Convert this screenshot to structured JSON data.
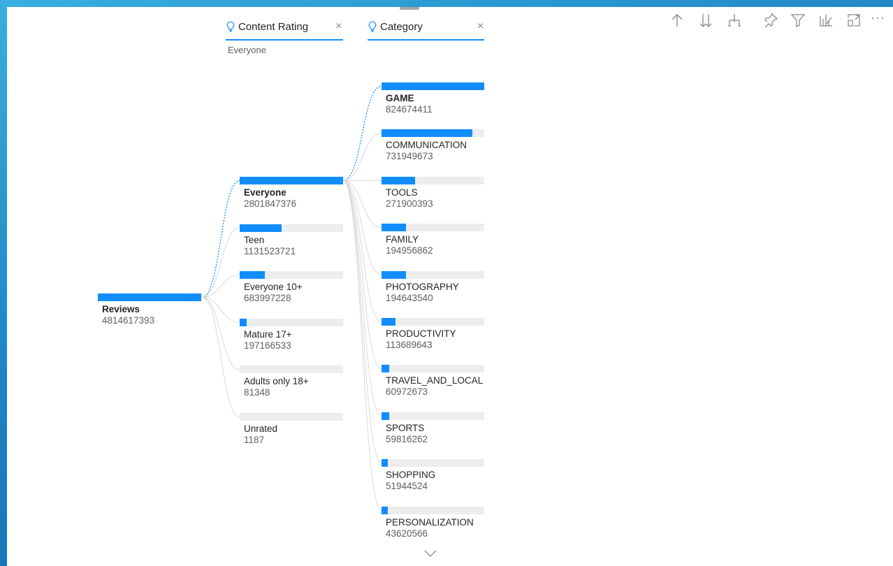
{
  "header": {
    "content_rating": {
      "title": "Content Rating",
      "subtitle": "Everyone",
      "close": "×"
    },
    "category": {
      "title": "Category",
      "close": "×"
    }
  },
  "toolbar": {
    "more": "···",
    "icons": [
      "drill-up-icon",
      "drill-down-icon",
      "expand-hierarchy-icon",
      "pin-icon",
      "filter-icon",
      "focus-mode-icon",
      "expand-icon",
      "more-options-icon"
    ]
  },
  "root": {
    "label": "Reviews",
    "value": "4814617393",
    "fraction": 1.0
  },
  "content_rating_nodes": [
    {
      "label": "Everyone",
      "value": "2801847376",
      "fraction": 1.0,
      "selected": true
    },
    {
      "label": "Teen",
      "value": "1131523721",
      "fraction": 0.4038,
      "selected": false
    },
    {
      "label": "Everyone 10+",
      "value": "683997228",
      "fraction": 0.2441,
      "selected": false
    },
    {
      "label": "Mature 17+",
      "value": "197166533",
      "fraction": 0.0704,
      "selected": false
    },
    {
      "label": "Adults only 18+",
      "value": "81348",
      "fraction": 3e-05,
      "selected": false
    },
    {
      "label": "Unrated",
      "value": "1187",
      "fraction": 4e-07,
      "selected": false
    }
  ],
  "category_nodes": [
    {
      "label": "GAME",
      "value": "824674411",
      "fraction": 1.0,
      "selected": true
    },
    {
      "label": "COMMUNICATION",
      "value": "731949673",
      "fraction": 0.8876,
      "selected": false
    },
    {
      "label": "TOOLS",
      "value": "271900393",
      "fraction": 0.3297,
      "selected": false
    },
    {
      "label": "FAMILY",
      "value": "194956862",
      "fraction": 0.2364,
      "selected": false
    },
    {
      "label": "PHOTOGRAPHY",
      "value": "194643540",
      "fraction": 0.236,
      "selected": false
    },
    {
      "label": "PRODUCTIVITY",
      "value": "113689643",
      "fraction": 0.1379,
      "selected": false
    },
    {
      "label": "TRAVEL_AND_LOCAL",
      "value": "60972673",
      "fraction": 0.0739,
      "selected": false
    },
    {
      "label": "SPORTS",
      "value": "59816262",
      "fraction": 0.0725,
      "selected": false
    },
    {
      "label": "SHOPPING",
      "value": "51944524",
      "fraction": 0.063,
      "selected": false
    },
    {
      "label": "PERSONALIZATION",
      "value": "43620566",
      "fraction": 0.0529,
      "selected": false
    }
  ],
  "colors": {
    "accent": "#118dff",
    "track": "#ededed",
    "connector_selected": "#118dff",
    "connector": "#d9d9d9"
  }
}
